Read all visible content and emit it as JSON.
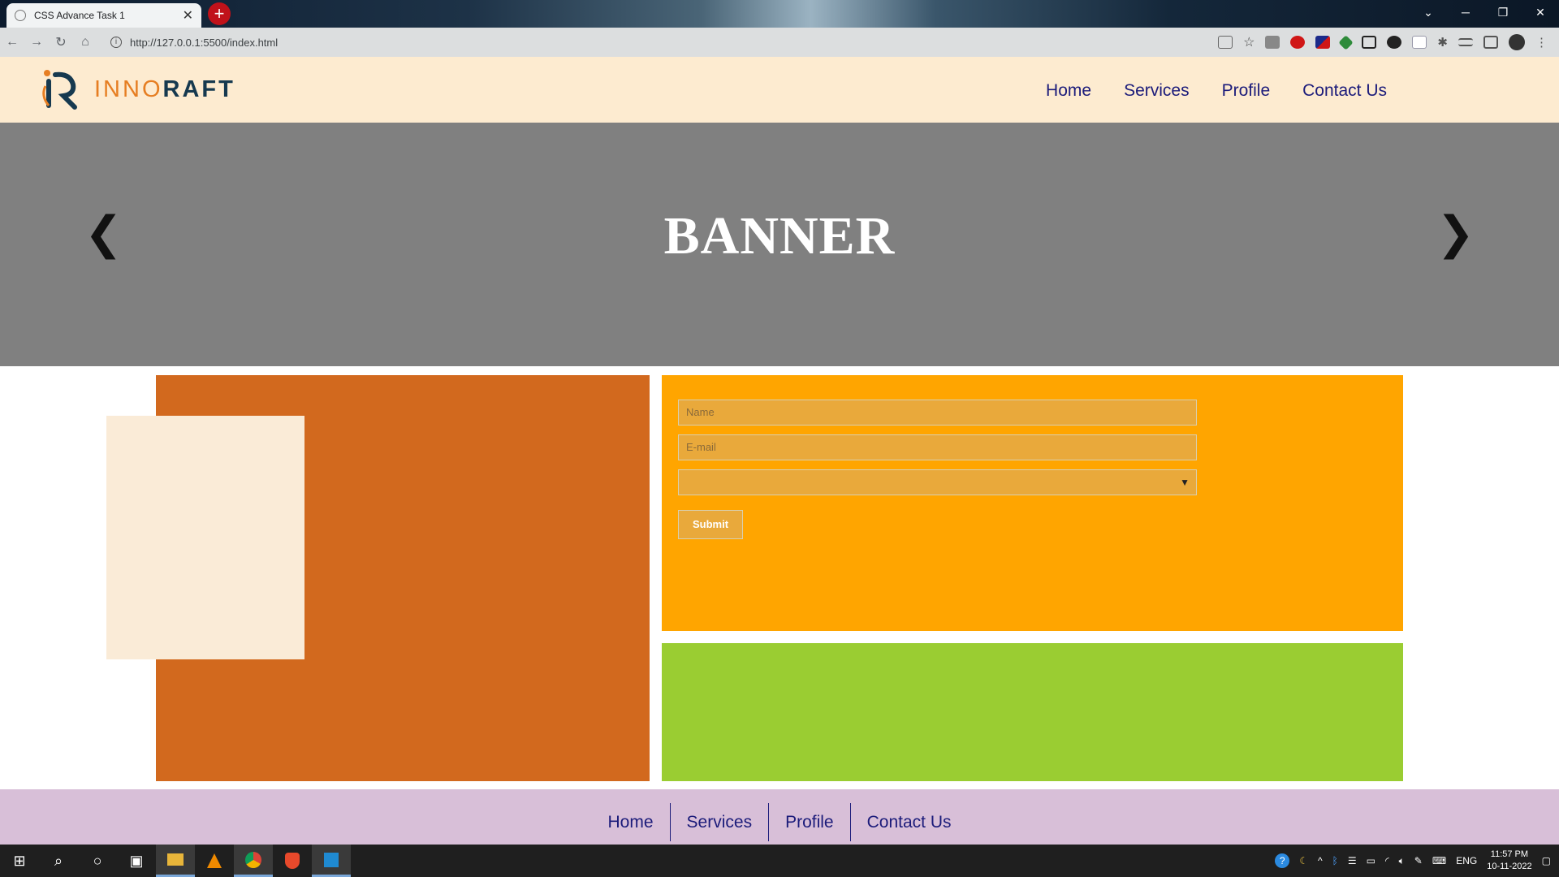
{
  "browser": {
    "tab_title": "CSS Advance Task 1",
    "tab_close": "✕",
    "new_tab": "+",
    "url": "http://127.0.0.1:5500/index.html",
    "window_controls": [
      "⌄",
      "─",
      "❐",
      "✕"
    ]
  },
  "header": {
    "logo_part1": "INNO",
    "logo_part2": "RAFT",
    "nav": [
      "Home",
      "Services",
      "Profile",
      "Contact Us"
    ]
  },
  "banner": {
    "title": "BANNER",
    "prev_arrow": "❮",
    "next_arrow": "❯"
  },
  "form": {
    "name_placeholder": "Name",
    "email_placeholder": "E-mail",
    "select_value": "",
    "submit_label": "Submit"
  },
  "footer": {
    "nav": [
      "Home",
      "Services",
      "Profile",
      "Contact Us"
    ]
  },
  "taskbar": {
    "language": "ENG",
    "time": "11:57 PM",
    "date": "10-11-2022"
  },
  "colors": {
    "header_bg": "#fdebd0",
    "banner_bg": "#808080",
    "orange_box": "#d2691e",
    "cream_box": "#faebd7",
    "form_box": "#ffa500",
    "green_box": "#9acd32",
    "footer_bg": "#d8bfd8",
    "nav_text": "#1b1b7a"
  }
}
